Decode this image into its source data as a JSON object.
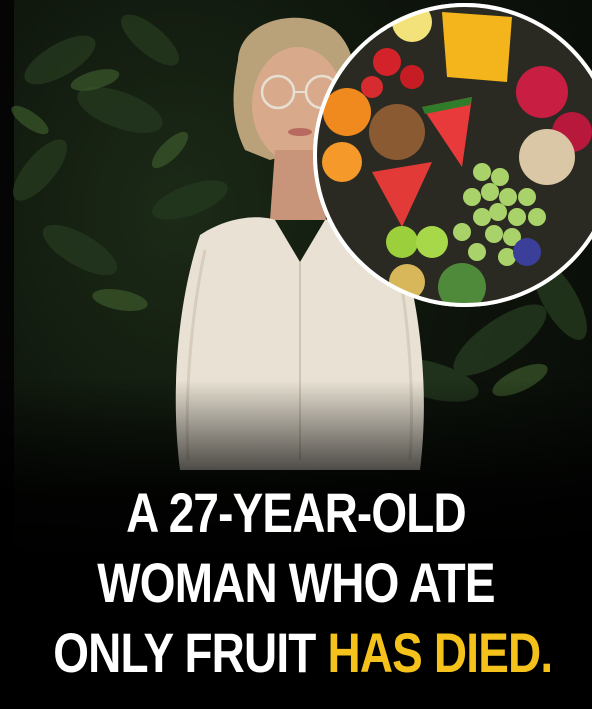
{
  "headline": {
    "line1": "A 27-YEAR-OLD",
    "line2": "WOMAN WHO ATE",
    "line3_start": "ONLY FRUIT ",
    "line3_accent": "HAS DIED."
  },
  "colors": {
    "text": "#ffffff",
    "accent": "#f4c21a",
    "background": "#000000",
    "foliage": "#1c2a17"
  },
  "image": {
    "subject": "woman-portrait",
    "inset": "fruit-platter-circle"
  }
}
